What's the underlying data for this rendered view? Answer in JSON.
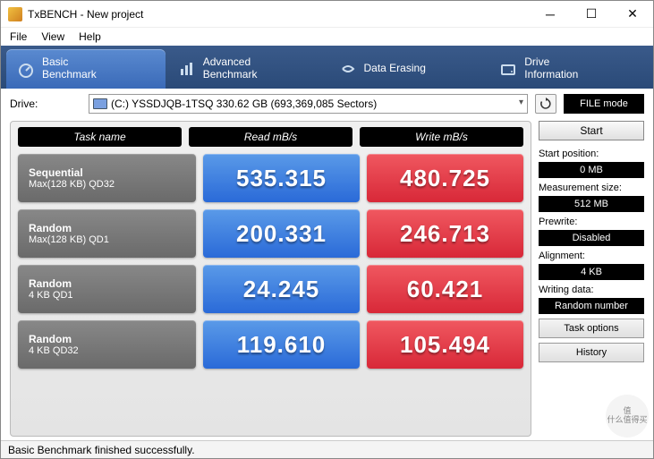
{
  "window": {
    "title": "TxBENCH - New project",
    "menus": [
      "File",
      "View",
      "Help"
    ]
  },
  "tabs": [
    {
      "label": "Basic\nBenchmark",
      "active": true
    },
    {
      "label": "Advanced\nBenchmark",
      "active": false
    },
    {
      "label": "Data Erasing",
      "active": false
    },
    {
      "label": "Drive\nInformation",
      "active": false
    }
  ],
  "drive": {
    "label": "Drive:",
    "selected": "(C:) YSSDJQB-1TSQ   330.62 GB (693,369,085 Sectors)",
    "file_mode_label": "FILE mode"
  },
  "headers": {
    "task": "Task name",
    "read": "Read mB/s",
    "write": "Write mB/s"
  },
  "rows": [
    {
      "title": "Sequential",
      "sub": "Max(128 KB) QD32",
      "read": "535.315",
      "write": "480.725"
    },
    {
      "title": "Random",
      "sub": "Max(128 KB) QD1",
      "read": "200.331",
      "write": "246.713"
    },
    {
      "title": "Random",
      "sub": "4 KB QD1",
      "read": "24.245",
      "write": "60.421"
    },
    {
      "title": "Random",
      "sub": "4 KB QD32",
      "read": "119.610",
      "write": "105.494"
    }
  ],
  "side": {
    "start": "Start",
    "start_position_label": "Start position:",
    "start_position": "0 MB",
    "measurement_size_label": "Measurement size:",
    "measurement_size": "512 MB",
    "prewrite_label": "Prewrite:",
    "prewrite": "Disabled",
    "alignment_label": "Alignment:",
    "alignment": "4 KB",
    "writing_data_label": "Writing data:",
    "writing_data": "Random number",
    "task_options": "Task options",
    "history": "History"
  },
  "status": "Basic Benchmark finished successfully.",
  "watermark": "值\n什么值得买"
}
